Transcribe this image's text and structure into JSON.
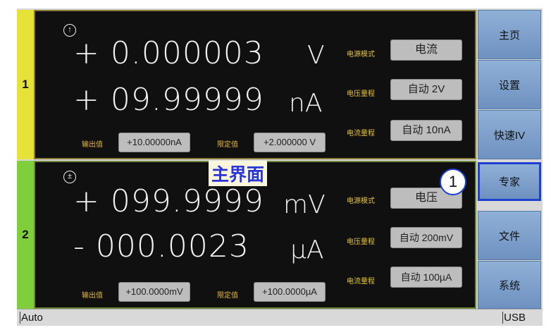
{
  "channels": [
    {
      "number": "1",
      "mode_icon": "↑",
      "mode_icon_name": "source-arrow-icon",
      "reading_primary": "+ 0.000003",
      "unit_primary": "V",
      "reading_secondary": "+ 09.99999",
      "unit_secondary": "nA",
      "source_mode_label": "电源模式",
      "source_mode_value": "电流",
      "voltage_range_label": "电压量程",
      "voltage_range_value": "自动 2V",
      "current_range_label": "电流量程",
      "current_range_value": "自动 10nA",
      "output_label": "输出值",
      "output_value": "+10.00000nA",
      "limit_label": "限定值",
      "limit_value": "+2.000000 V"
    },
    {
      "number": "2",
      "mode_icon": "±",
      "mode_icon_name": "plus-minus-icon",
      "reading_primary": "+ 099.9999",
      "unit_primary": "mV",
      "reading_secondary": "- 000.0023",
      "unit_secondary": "µA",
      "source_mode_label": "电源模式",
      "source_mode_value": "电压",
      "voltage_range_label": "电压量程",
      "voltage_range_value": "自动 200mV",
      "current_range_label": "电流量程",
      "current_range_value": "自动 100µA",
      "output_label": "输出值",
      "output_value": "+100.0000mV",
      "limit_label": "限定值",
      "limit_value": "+100.0000µA"
    }
  ],
  "sidebar": {
    "items": [
      {
        "label": "主页"
      },
      {
        "label": "设置"
      },
      {
        "label": "快速IV"
      },
      {
        "label": "专家",
        "active": true
      },
      {
        "label": "文件"
      },
      {
        "label": "系统"
      }
    ]
  },
  "status": {
    "left": "Auto",
    "right": "USB"
  },
  "annotation": {
    "title": "主界面",
    "marker": "1"
  },
  "colors": {
    "channel1_tab": "#e7e23a",
    "channel2_tab": "#7fce3b",
    "side_button": "#8fb0d6",
    "highlight": "#1f3fd0",
    "annotation_text": "#2a35d8"
  }
}
